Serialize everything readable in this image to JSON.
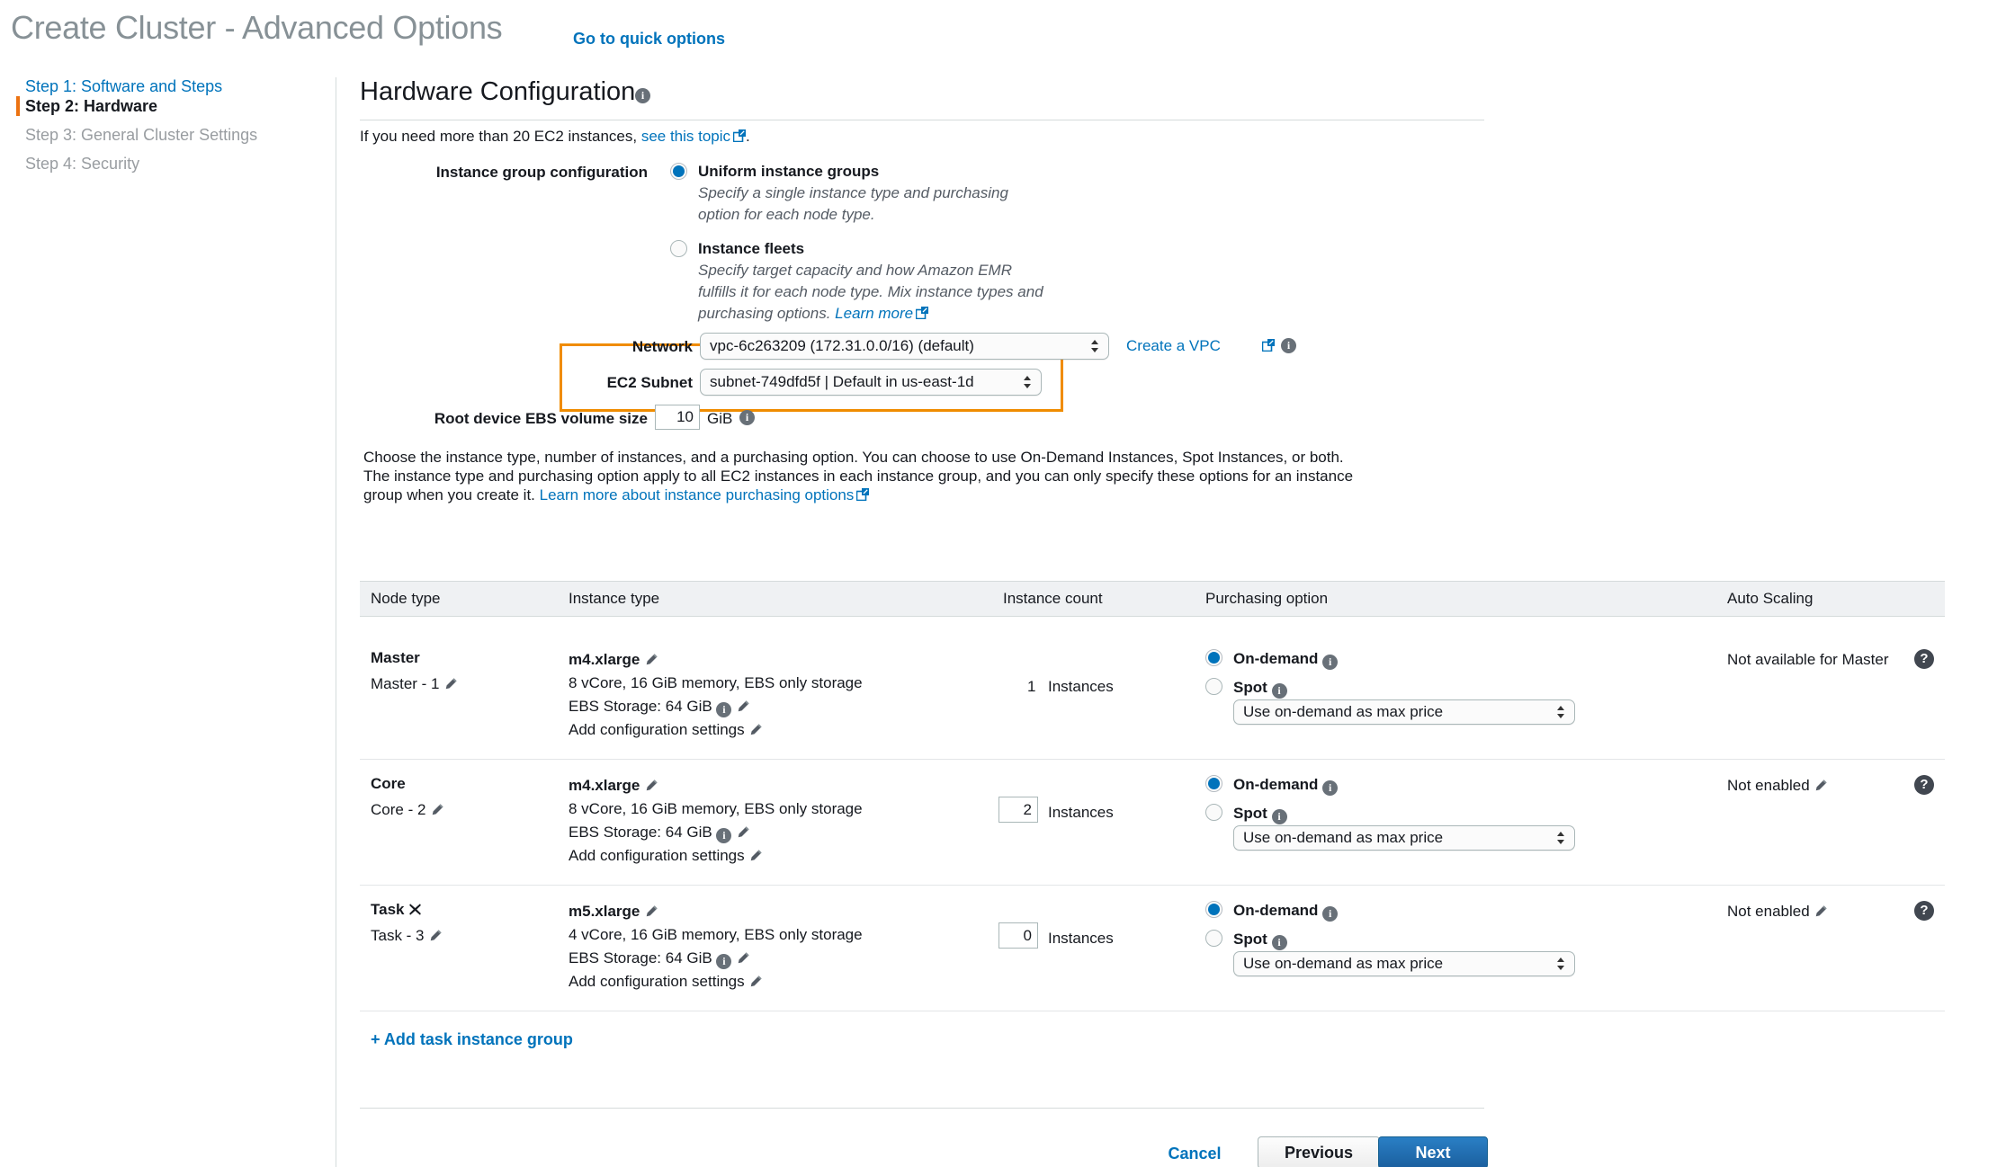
{
  "header": {
    "title": "Create Cluster - Advanced Options",
    "quick_options_link": "Go to quick options"
  },
  "sidebar": {
    "items": [
      {
        "label": "Step 1: Software and Steps",
        "state": "link"
      },
      {
        "label": "Step 2: Hardware",
        "state": "current"
      },
      {
        "label": "Step 3: General Cluster Settings",
        "state": "muted"
      },
      {
        "label": "Step 4: Security",
        "state": "muted"
      }
    ],
    "marker_color": "#ec7211"
  },
  "main": {
    "section_title": "Hardware Configuration",
    "hint_prefix": "If you need more than 20 EC2 instances,",
    "hint_link": "see this topic",
    "hint_suffix": ".",
    "instance_group_config": {
      "label": "Instance group configuration",
      "options": [
        {
          "title": "Uniform instance groups",
          "selected": true,
          "description_line1": "Specify a single instance type and purchasing",
          "description_line2": "option for each node type."
        },
        {
          "title": "Instance fleets",
          "selected": false,
          "description_line1": "Specify target capacity and how Amazon EMR",
          "description_line2": "fulfills it for each node type. Mix instance types and",
          "description_line3": "purchasing options.",
          "description_link": "Learn more"
        }
      ]
    },
    "network": {
      "label": "Network",
      "value": "vpc-6c263209 (172.31.0.0/16) (default)",
      "create_vpc_link": "Create a VPC"
    },
    "subnet": {
      "label": "EC2 Subnet",
      "value": "subnet-749dfd5f | Default in us-east-1d"
    },
    "root_volume": {
      "label": "Root device EBS volume size",
      "value": "10",
      "unit": "GiB"
    },
    "paragraph": {
      "line1": "Choose the instance type, number of instances, and a purchasing option. You can choose to use On-Demand Instances, Spot Instances, or both.",
      "line2": "The instance type and purchasing option apply to all EC2 instances in each instance group, and you can only specify these options for an instance",
      "line3_prefix": "group when you create it.",
      "line3_link": "Learn more about instance purchasing options"
    },
    "highlight_color": "#f08c00",
    "accent_color": "#0073bb"
  },
  "table": {
    "columns": [
      "Node type",
      "Instance type",
      "Instance count",
      "Purchasing option",
      "Auto Scaling"
    ],
    "rows": [
      {
        "node_type": "Master",
        "node_name": "Master - 1",
        "removable": false,
        "instance_type": "m4.xlarge",
        "instance_specs": "8 vCore, 16 GiB memory, EBS only storage",
        "ebs_storage_label": "EBS Storage:",
        "ebs_storage_value": "64 GiB",
        "add_config_label": "Add configuration settings",
        "count": "1",
        "count_editable": false,
        "count_unit": "Instances",
        "purchasing": {
          "ondemand_label": "On-demand",
          "ondemand_selected": true,
          "spot_label": "Spot",
          "spot_selected": false,
          "spot_price_option": "Use on-demand as max price"
        },
        "auto_scaling": "Not available for Master",
        "auto_scaling_editable": false
      },
      {
        "node_type": "Core",
        "node_name": "Core - 2",
        "removable": false,
        "instance_type": "m4.xlarge",
        "instance_specs": "8 vCore, 16 GiB memory, EBS only storage",
        "ebs_storage_label": "EBS Storage:",
        "ebs_storage_value": "64 GiB",
        "add_config_label": "Add configuration settings",
        "count": "2",
        "count_editable": true,
        "count_unit": "Instances",
        "purchasing": {
          "ondemand_label": "On-demand",
          "ondemand_selected": true,
          "spot_label": "Spot",
          "spot_selected": false,
          "spot_price_option": "Use on-demand as max price"
        },
        "auto_scaling": "Not enabled",
        "auto_scaling_editable": true
      },
      {
        "node_type": "Task",
        "node_name": "Task - 3",
        "removable": true,
        "instance_type": "m5.xlarge",
        "instance_specs": "4 vCore, 16 GiB memory, EBS only storage",
        "ebs_storage_label": "EBS Storage:",
        "ebs_storage_value": "64 GiB",
        "add_config_label": "Add configuration settings",
        "count": "0",
        "count_editable": true,
        "count_unit": "Instances",
        "purchasing": {
          "ondemand_label": "On-demand",
          "ondemand_selected": true,
          "spot_label": "Spot",
          "spot_selected": false,
          "spot_price_option": "Use on-demand as max price"
        },
        "auto_scaling": "Not enabled",
        "auto_scaling_editable": true
      }
    ],
    "add_task_group_link": "+ Add task instance group"
  },
  "footer": {
    "cancel": "Cancel",
    "previous": "Previous",
    "next": "Next"
  }
}
